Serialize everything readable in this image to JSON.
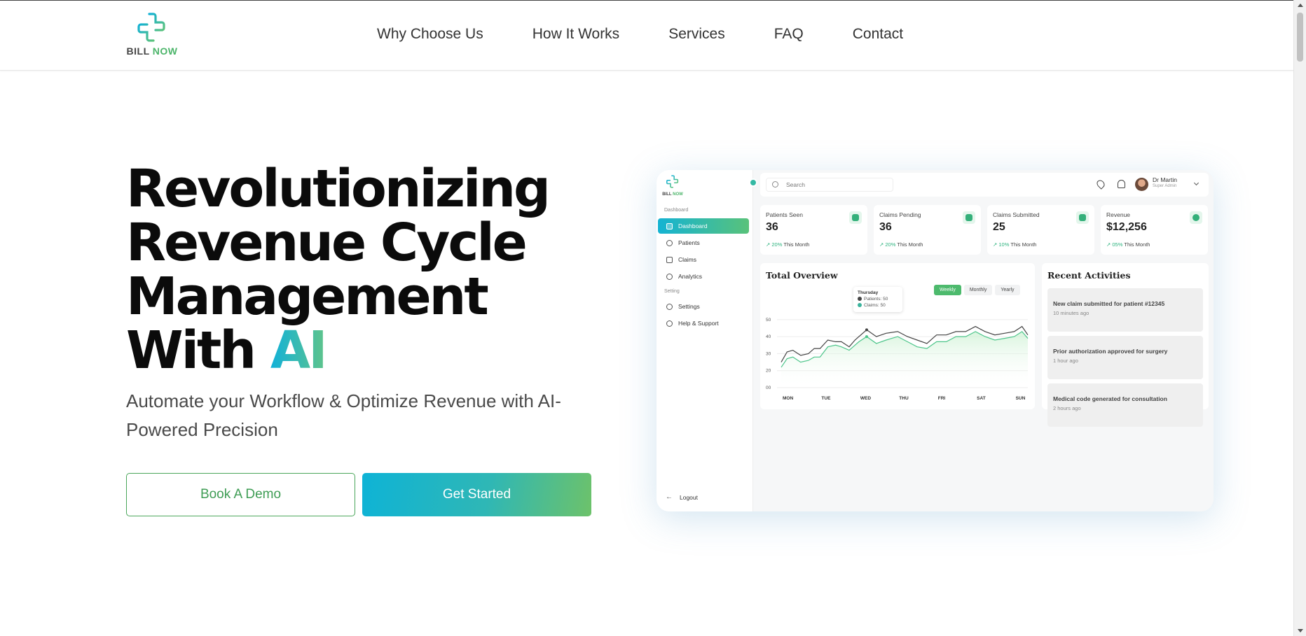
{
  "header": {
    "logo": {
      "word1": "BILL",
      "word2": "NOW"
    },
    "nav": [
      "Why Choose Us",
      "How It Works",
      "Services",
      "FAQ",
      "Contact"
    ]
  },
  "hero": {
    "title_lines": [
      "Revolutionizing",
      "Revenue Cycle",
      "Management",
      "With"
    ],
    "title_highlight": "AI",
    "subtitle": "Automate your Workflow & Optimize Revenue with AI- Powered Precision",
    "book_demo": "Book A Demo",
    "get_started": "Get Started"
  },
  "dashboard": {
    "logo": {
      "word1": "BILL",
      "word2": "NOW"
    },
    "sidebar": {
      "section1": "Dashboard",
      "items": [
        "Dashboard",
        "Patients",
        "Claims",
        "Analytics"
      ],
      "section2": "Setting",
      "items2": [
        "Settings",
        "Help & Support"
      ],
      "logout": "Logout"
    },
    "search_placeholder": "Search",
    "user": {
      "name": "Dr Martin",
      "role": "Super Admin"
    },
    "stats": [
      {
        "label": "Patients Seen",
        "value": "36",
        "pct": "20%",
        "period": "This Month"
      },
      {
        "label": "Claims Pending",
        "value": "36",
        "pct": "20%",
        "period": "This Month"
      },
      {
        "label": "Claims Submitted",
        "value": "25",
        "pct": "10%",
        "period": "This Month"
      },
      {
        "label": "Revenue",
        "value": "$12,256",
        "pct": "05%",
        "period": "This Month"
      }
    ],
    "overview": {
      "title": "Total Overview",
      "tabs": [
        "Weekly",
        "Monthly",
        "Yearly"
      ],
      "active_tab": "Weekly",
      "tooltip": {
        "day": "Thursday",
        "line1": "Patients: 50",
        "line2": "Claims: 50"
      }
    },
    "activities": {
      "title": "Recent Activities",
      "items": [
        {
          "text": "New claim submitted for patient #12345",
          "time": "10 minutes ago"
        },
        {
          "text": "Prior authorization approved for surgery",
          "time": "1 hour ago"
        },
        {
          "text": "Medical code generated for consultation",
          "time": "2 hours ago"
        }
      ]
    },
    "colors": {
      "accent_green": "#4dba6d",
      "accent_teal": "#14b3d3",
      "patients_line": "#444444",
      "claims_line": "#4cc58a"
    }
  },
  "chart_data": {
    "type": "line",
    "title": "Total Overview",
    "categories": [
      "MON",
      "TUE",
      "WED",
      "THU",
      "FRI",
      "SAT",
      "SUN"
    ],
    "ytick_labels": [
      "00",
      "20",
      "30",
      "40",
      "50"
    ],
    "yticks": [
      10,
      20,
      30,
      40,
      50
    ],
    "ylim": [
      10,
      52
    ],
    "x": [
      0,
      0.15,
      0.3,
      0.5,
      0.7,
      0.85,
      1.0,
      1.2,
      1.4,
      1.55,
      1.75,
      1.9,
      2.0,
      2.2,
      2.45,
      2.7,
      3.0,
      3.25,
      3.5,
      3.75,
      4.0,
      4.25,
      4.5,
      4.75,
      5.0,
      5.25,
      5.5,
      5.75,
      6.0,
      6.2,
      6.35
    ],
    "series": [
      {
        "name": "Patients",
        "values": [
          25,
          31,
          32,
          29,
          30,
          33,
          33,
          38,
          37,
          37,
          34,
          38,
          40,
          44,
          40,
          42,
          43,
          40,
          38,
          36,
          41,
          41,
          43,
          43,
          46,
          43,
          41,
          42,
          43,
          46,
          41
        ]
      },
      {
        "name": "Claims",
        "values": [
          22,
          27,
          28,
          25,
          26,
          28,
          28,
          34,
          35,
          34,
          32,
          35,
          37,
          40,
          36,
          38,
          40,
          37,
          34,
          33,
          37,
          37,
          40,
          40,
          43,
          40,
          38,
          39,
          40,
          43,
          39
        ]
      }
    ],
    "legend": "tooltip"
  }
}
